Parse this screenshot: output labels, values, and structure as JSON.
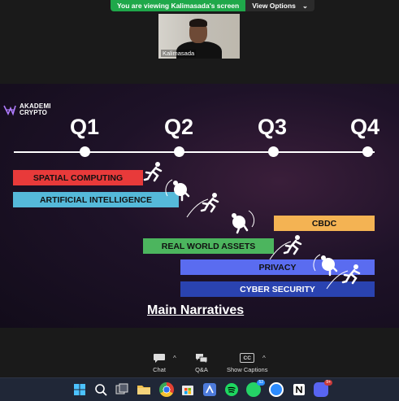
{
  "banner": {
    "message": "You are viewing Kalimasada's screen",
    "options_label": "View Options",
    "chevron": "⌄"
  },
  "video": {
    "participant_name": "Kalimasada"
  },
  "slide": {
    "logo_line1": "AKADEMI",
    "logo_line2": "CRYPTO",
    "quarters": [
      "Q1",
      "Q2",
      "Q3",
      "Q4"
    ],
    "bars": [
      {
        "label": "SPATIAL COMPUTING",
        "color": "#e83a3a"
      },
      {
        "label": "ARTIFICIAL INTELLIGENCE",
        "color": "#55b9d9"
      },
      {
        "label": "CBDC",
        "color": "#f4b353"
      },
      {
        "label": "REAL WORLD ASSETS",
        "color": "#4cb55e"
      },
      {
        "label": "PRIVACY",
        "color": "#5a6cf0"
      },
      {
        "label": "CYBER SECURITY",
        "color": "#2a43b0"
      }
    ],
    "footer_title": "Main Narratives"
  },
  "controls": {
    "chat_label": "Chat",
    "qa_label": "Q&A",
    "captions_label": "Show Captions",
    "cc_text": "CC",
    "caret": "^"
  },
  "taskbar": {
    "icons": [
      "windows-start-icon",
      "search-icon",
      "task-view-icon",
      "file-explorer-icon",
      "chrome-icon",
      "store-icon",
      "app-icon",
      "spotify-icon",
      "whatsapp-icon",
      "zoom-icon",
      "notion-icon",
      "discord-icon"
    ],
    "whatsapp_badge": "52",
    "discord_badge": "9+",
    "chrome_badge": ""
  }
}
